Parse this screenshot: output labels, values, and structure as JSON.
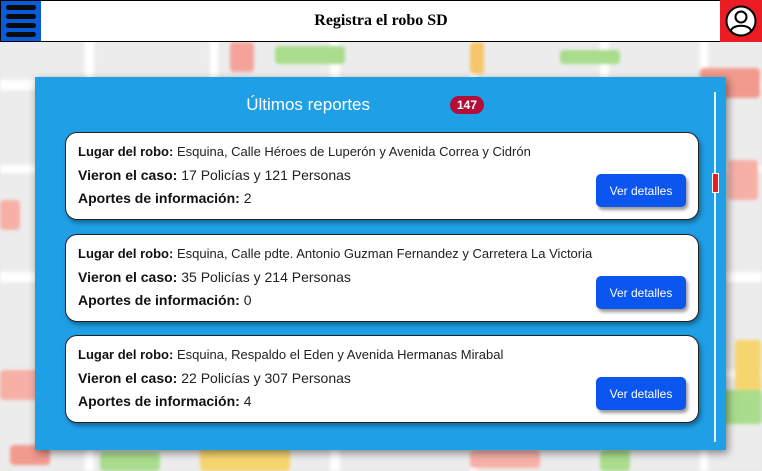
{
  "header": {
    "title": "Registra el robo SD"
  },
  "icons": {
    "menu": "hamburger-menu-icon",
    "profile": "user-profile-icon"
  },
  "colors": {
    "menu_button": "#0a5bd8",
    "profile_button": "#ec1c24",
    "panel": "#1f9fe6",
    "badge": "#b30e3a",
    "details_button": "#0b55f0"
  },
  "panel": {
    "title": "Últimos reportes",
    "count": "147"
  },
  "reports": [
    {
      "place_label": "Lugar del robo:",
      "place": "Esquina, Calle Héroes de Luperón y Avenida Correa y Cidrón",
      "seen_label": "Vieron el caso:",
      "seen": "17 Policías y 121 Personas",
      "contrib_label": "Aportes de información:",
      "contrib": "2",
      "button": "Ver detalles"
    },
    {
      "place_label": "Lugar del robo:",
      "place": "Esquina, Calle pdte. Antonio Guzman Fernandez y Carretera La Victoria",
      "seen_label": "Vieron el caso:",
      "seen": "35 Policías y 214 Personas",
      "contrib_label": "Aportes de información:",
      "contrib": "0",
      "button": "Ver detalles"
    },
    {
      "place_label": "Lugar del robo:",
      "place": "Esquina, Respaldo el Eden y Avenida Hermanas Mirabal",
      "seen_label": "Vieron el caso:",
      "seen": "22 Policías y 307 Personas",
      "contrib_label": "Aportes de información:",
      "contrib": "4",
      "button": "Ver detalles"
    }
  ]
}
